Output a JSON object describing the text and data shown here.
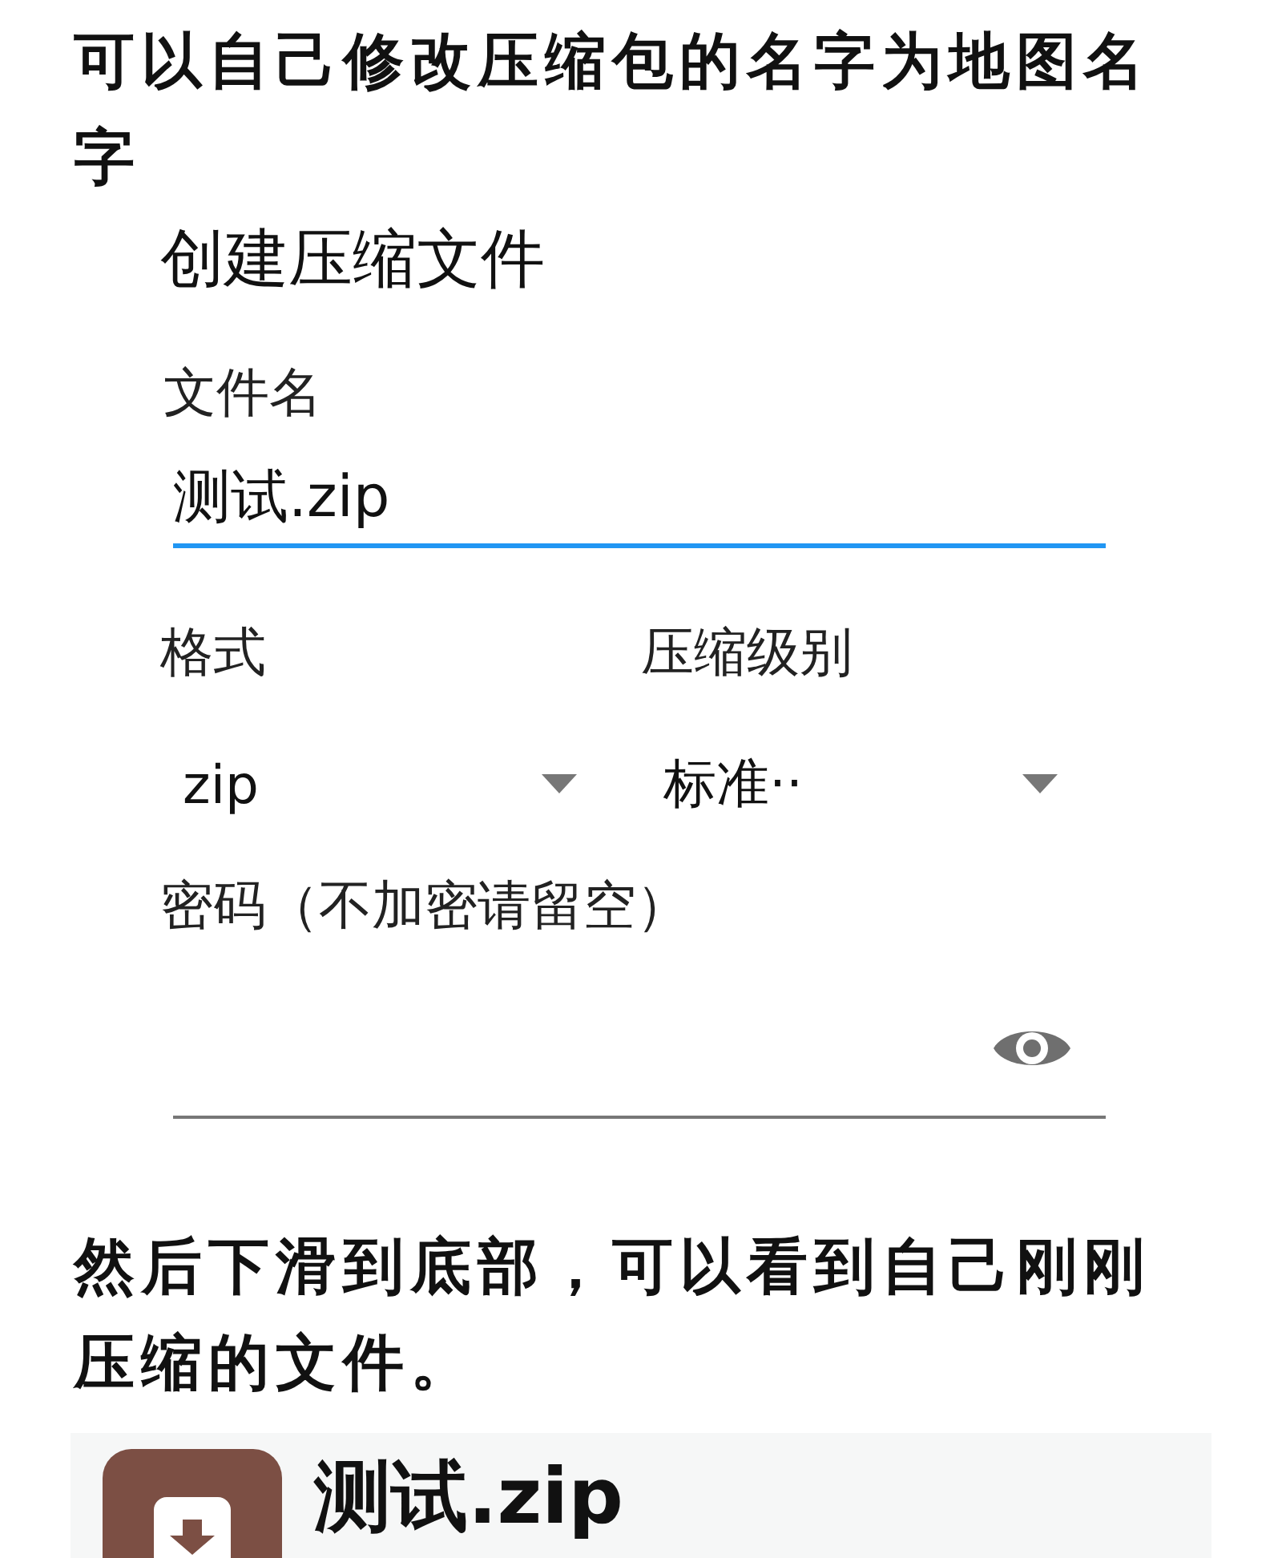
{
  "intro": "可以自己修改压缩包的名字为地图名字",
  "dialog": {
    "title": "创建压缩文件",
    "filename": {
      "label": "文件名",
      "value": "测试.zip",
      "focused": true
    },
    "selects": [
      {
        "label": "格式",
        "value": "zip"
      },
      {
        "label": "压缩级别",
        "value": "标准··"
      }
    ],
    "password": {
      "label": "密码（不加密请留空）"
    }
  },
  "outro": "然后下滑到底部，可以看到自己刚刚压缩的文件。",
  "file": {
    "name": "测试.zip"
  }
}
